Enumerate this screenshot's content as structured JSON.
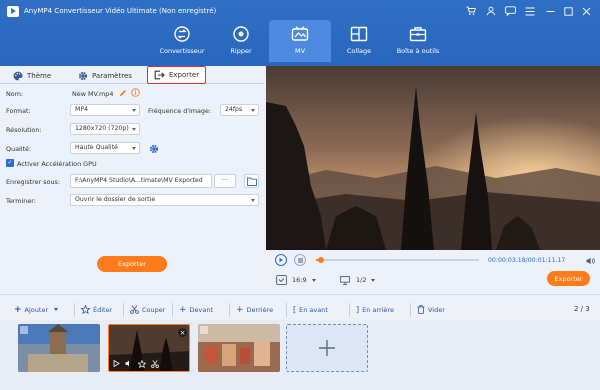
{
  "app": {
    "title": "AnyMP4 Convertisseur Vidéo Ultimate (Non enregistré)"
  },
  "nav": [
    {
      "label": "Convertisseur",
      "icon": "convert-icon"
    },
    {
      "label": "Ripper",
      "icon": "disc-icon"
    },
    {
      "label": "MV",
      "icon": "mv-icon",
      "active": true
    },
    {
      "label": "Collage",
      "icon": "collage-icon"
    },
    {
      "label": "Boîte à outils",
      "icon": "toolbox-icon"
    }
  ],
  "tabs": {
    "theme": "Thème",
    "settings": "Paramètres",
    "export": "Exporter"
  },
  "form": {
    "name_label": "Nom:",
    "name_value": "New MV.mp4",
    "format_label": "Format:",
    "format_value": "MP4",
    "fps_label": "Fréquence d'image:",
    "fps_value": "24fps",
    "resolution_label": "Résolution:",
    "resolution_value": "1280x720 (720p)",
    "quality_label": "Qualité:",
    "quality_value": "Haute Qualité",
    "gpu_label": "Activer Accélération GPU",
    "save_label": "Enregistrer sous:",
    "save_path": "F:\\AnyMP4 Studio\\A...timate\\MV Exported",
    "browse": "···",
    "finish_label": "Terminer:",
    "finish_value": "Ouvrir le dossier de sortie",
    "export_button": "Exporter"
  },
  "player": {
    "time": "00:00:03.18/00:01:11.17",
    "progress": 0.03,
    "aspect": "16:9",
    "screen": "1/2",
    "export_button": "Exporter"
  },
  "toolbar": {
    "add": "Ajouter",
    "edit": "Éditer",
    "cut": "Couper",
    "front": "Devant",
    "back": "Derrière",
    "forward": "En avant",
    "backward": "En arrière",
    "clear": "Vider",
    "page": "2 / 3"
  },
  "colors": {
    "accent": "#2b6ccf",
    "orange": "#ff7a1a",
    "header": "#2f6fc4"
  }
}
